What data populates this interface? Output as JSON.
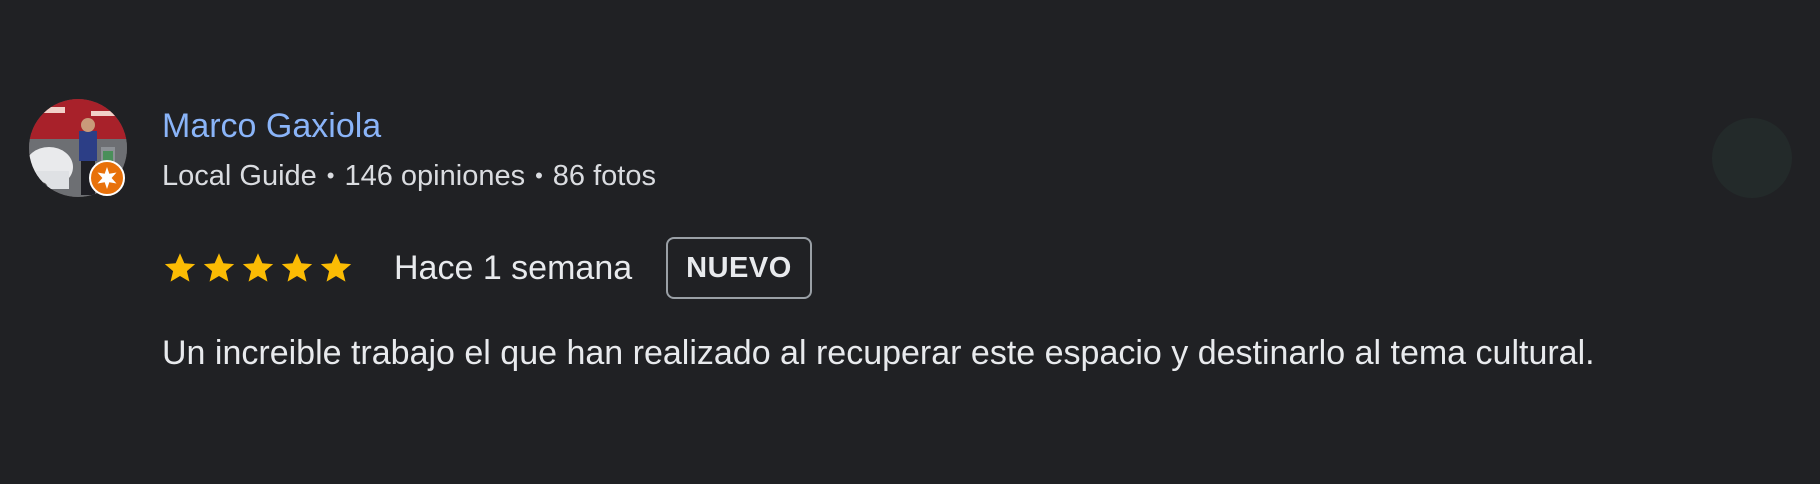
{
  "review": {
    "reviewer_name": "Marco Gaxiola",
    "reviewer_level": "Local Guide",
    "reviews_count": "146 opiniones",
    "photos_count": "86 fotos",
    "separator": "•",
    "rating": 5,
    "rating_max": 5,
    "date": "Hace 1 semana",
    "new_badge": "NUEVO",
    "text": "Un increible trabajo el que han realizado al recuperar este espacio y destinarlo al tema cultural."
  },
  "colors": {
    "background": "#202124",
    "name": "#8ab4f8",
    "star": "#fbbc04",
    "guide_badge": "#e8710a"
  },
  "icons": {
    "guide_badge": "local-guide-badge-icon",
    "star": "star-icon"
  }
}
